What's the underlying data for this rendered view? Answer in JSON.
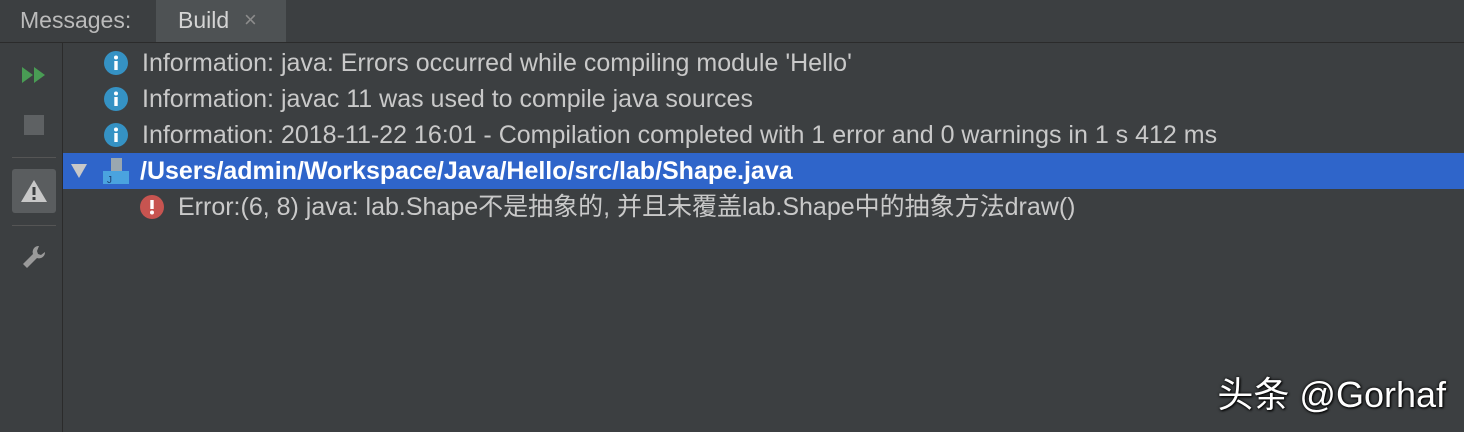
{
  "tabs": {
    "caption": "Messages:",
    "active": {
      "label": "Build",
      "close": "×"
    }
  },
  "toolbar": [
    {
      "icon": "rerun-icon"
    },
    {
      "icon": "stop-icon"
    },
    {
      "icon": "warning-filter-icon",
      "active": true
    },
    {
      "icon": "wrench-icon"
    }
  ],
  "messages": [
    {
      "type": "info",
      "icon": "info-icon",
      "text": "Information: java: Errors occurred while compiling module 'Hello'"
    },
    {
      "type": "info",
      "icon": "info-icon",
      "text": "Information: javac 11 was used to compile java sources"
    },
    {
      "type": "info",
      "icon": "info-icon",
      "text": "Information: 2018-11-22 16:01 - Compilation completed with 1 error and 0 warnings in 1 s 412 ms"
    },
    {
      "type": "file",
      "icon": "java-file-icon",
      "expanded": true,
      "selected": true,
      "text": "/Users/admin/Workspace/Java/Hello/src/lab/Shape.java"
    },
    {
      "type": "error",
      "icon": "error-icon",
      "text": "Error:(6, 8)  java: lab.Shape不是抽象的, 并且未覆盖lab.Shape中的抽象方法draw()"
    }
  ],
  "watermark": "头条 @Gorhaf",
  "colors": {
    "background": "#3c3f41",
    "selection": "#2f65ca",
    "info": "#3592c4",
    "error": "#c75450",
    "run": "#499c54"
  }
}
